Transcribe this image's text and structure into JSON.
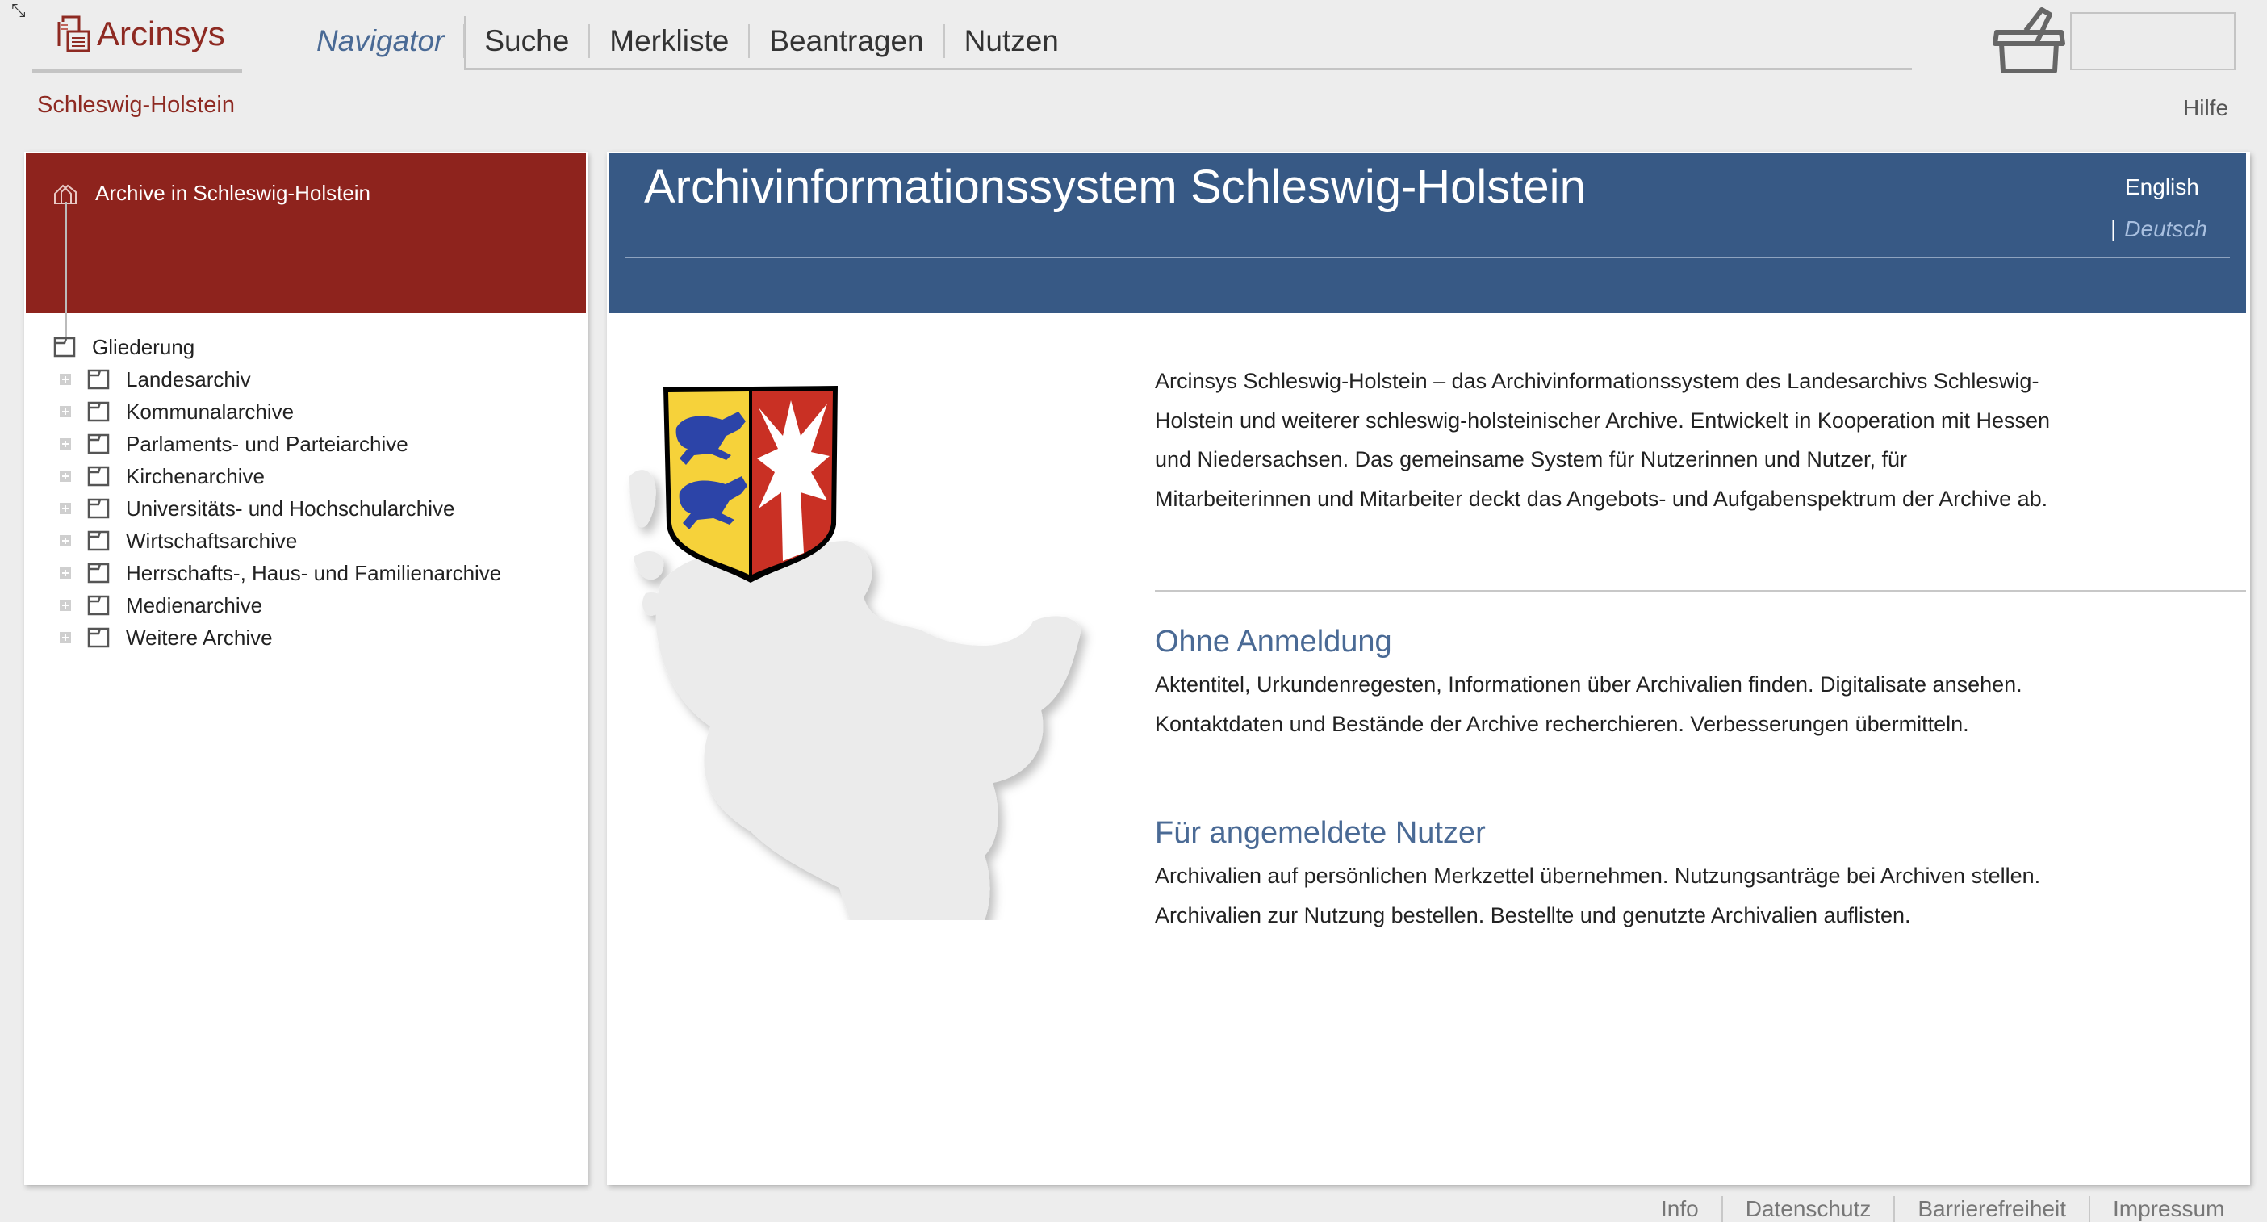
{
  "header": {
    "logo_text": "Arcinsys",
    "region": "Schleswig-Holstein",
    "nav": [
      "Navigator",
      "Suche",
      "Merkliste",
      "Beantragen",
      "Nutzen"
    ],
    "help": "Hilfe",
    "basket_icon": "basket-icon"
  },
  "sidebar": {
    "title": "Archive in Schleswig-Holstein",
    "root": "Gliederung",
    "items": [
      "Landesarchiv",
      "Kommunalarchive",
      "Parlaments- und Parteiarchive",
      "Kirchenarchive",
      "Universitäts- und Hochschularchive",
      "Wirtschaftsarchive",
      "Herrschafts-, Haus- und Familienarchive",
      "Medienarchive",
      "Weitere Archive"
    ]
  },
  "main": {
    "title": "Archivinformationssystem Schleswig-Holstein",
    "lang_english": "English",
    "lang_separator": "|",
    "lang_deutsch": "Deutsch",
    "intro": "Arcinsys Schleswig-Holstein – das Archivinformationssystem des Landesarchivs Schleswig-Holstein und weiterer schleswig-holsteinischer Archive. Entwickelt in Kooperation mit Hessen und Niedersachsen. Das gemeinsame System für Nutzerinnen und Nutzer, für Mitarbeiterinnen und Mitarbeiter deckt das Angebots- und Aufgabenspektrum der Archive ab.",
    "section1_title": "Ohne Anmeldung",
    "section1_text": "Aktentitel, Urkundenregesten, Informationen über Archivalien finden. Digitalisate ansehen. Kontaktdaten und Bestände der Archive recherchieren. Verbesserungen übermitteln.",
    "section2_title": "Für angemeldete Nutzer",
    "section2_text": "Archivalien auf persönlichen Merkzettel übernehmen. Nutzungsanträge bei Archiven stellen. Archivalien zur Nutzung bestellen. Bestellte und genutzte Archivalien auflisten."
  },
  "footer": [
    "Info",
    "Datenschutz",
    "Barrierefreiheit",
    "Impressum"
  ],
  "colors": {
    "brand_red": "#8e231d",
    "header_blue": "#375985",
    "link_blue": "#4a6a95",
    "background": "#ededed"
  }
}
